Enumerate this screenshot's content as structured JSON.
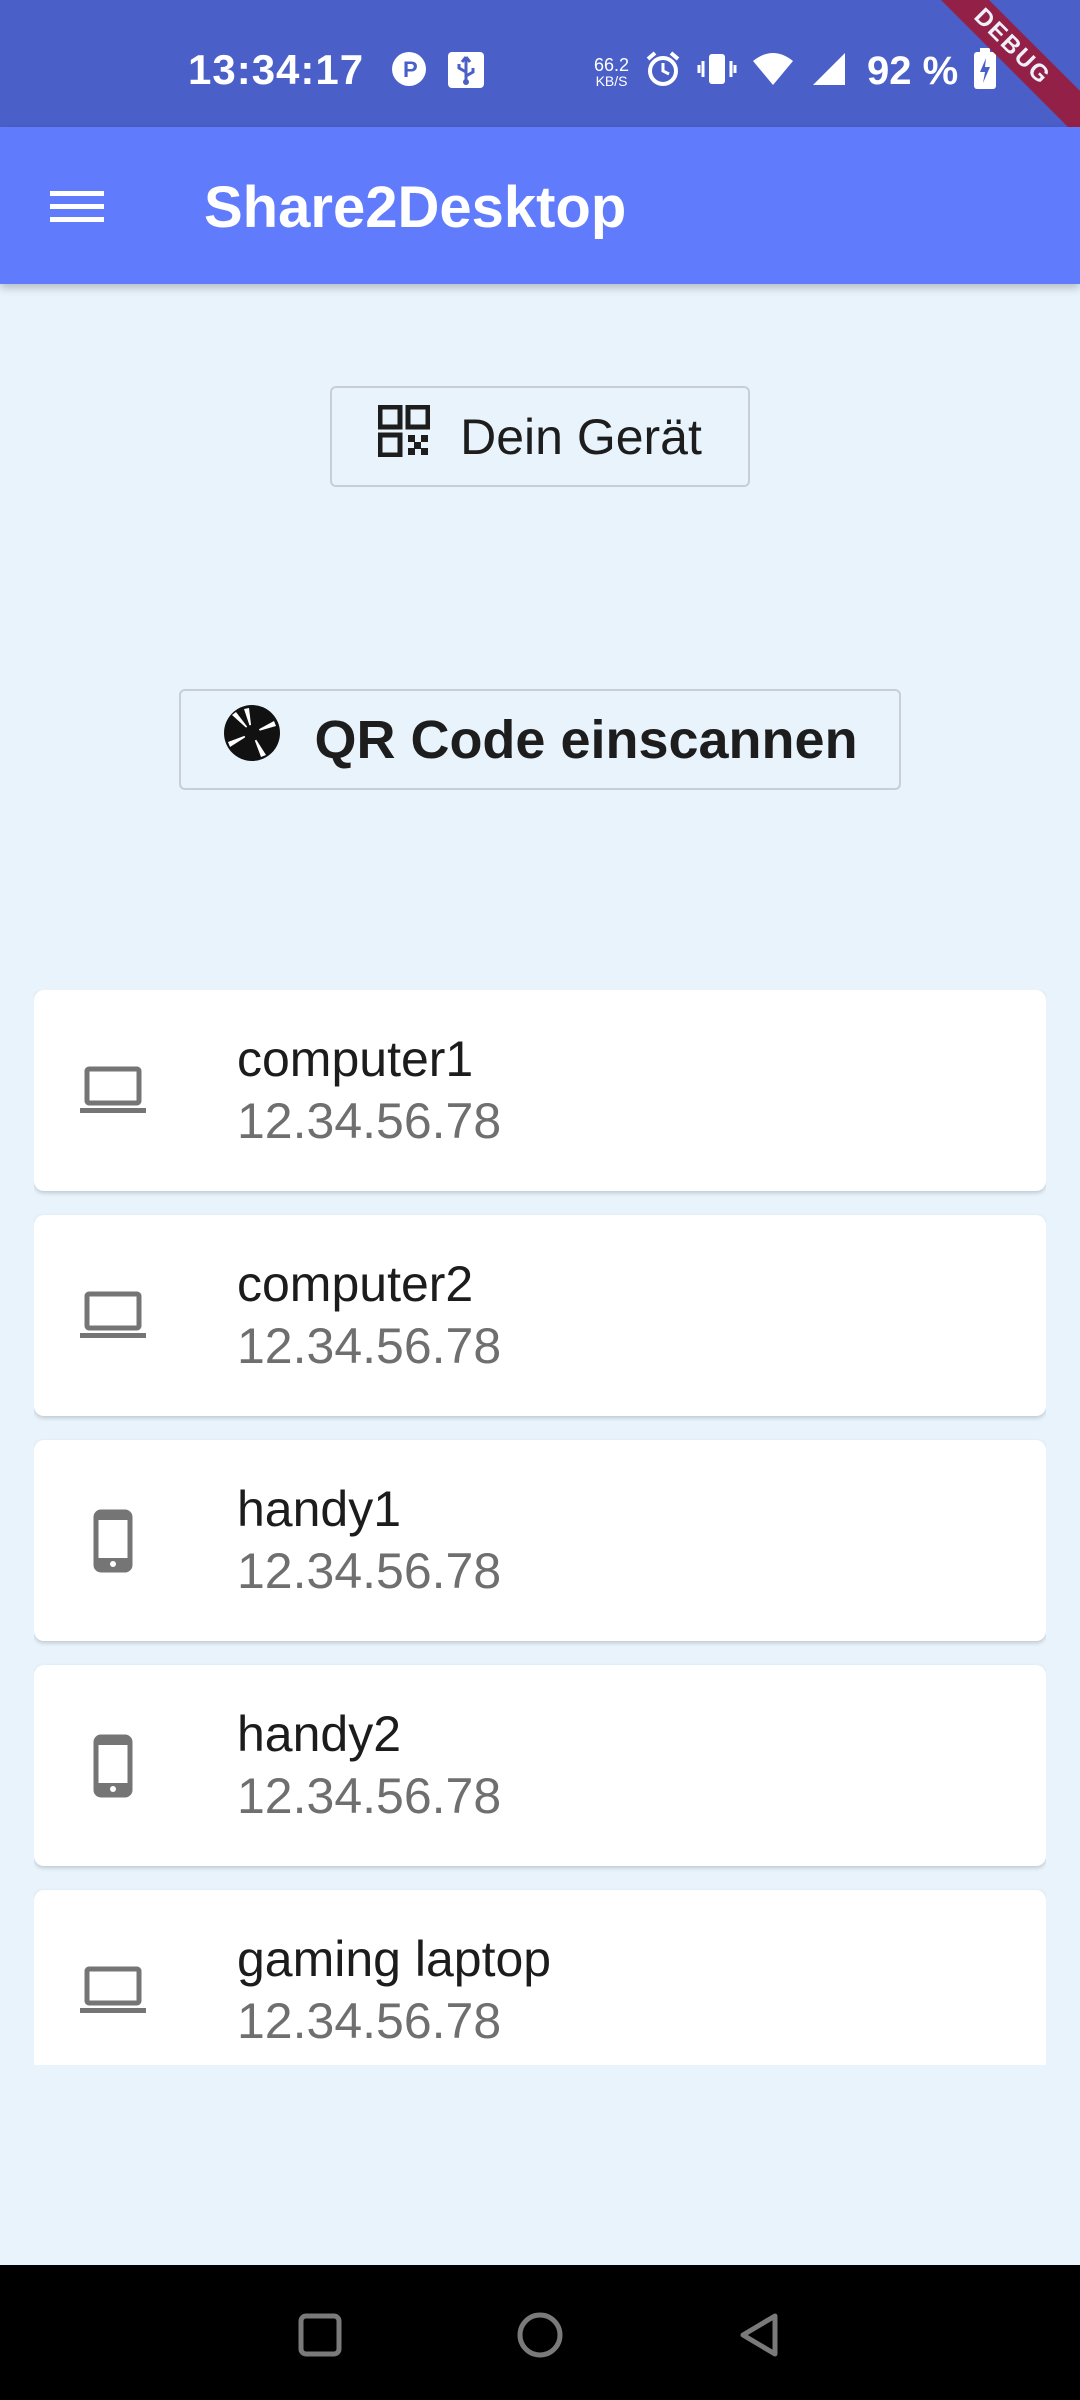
{
  "status_bar": {
    "time": "13:34:17",
    "net_speed_value": "66.2",
    "net_speed_unit": "KB/S",
    "battery": "92 %",
    "debug_label": "DEBUG",
    "left_icons": [
      "p-circle-icon",
      "usb-icon"
    ],
    "right_icons": [
      "alarm-icon",
      "vibrate-icon",
      "wifi-icon",
      "signal-icon",
      "battery-charging-icon"
    ]
  },
  "app_bar": {
    "title": "Share2Desktop",
    "menu_icon": "menu-icon",
    "color": "#607cfd"
  },
  "actions": {
    "your_device_label": "Dein Gerät",
    "your_device_icon": "qr-code-icon",
    "scan_label": "QR Code einscannen",
    "scan_icon": "camera-shutter-icon"
  },
  "devices": [
    {
      "name": "computer1",
      "ip": "12.34.56.78",
      "icon": "laptop-icon"
    },
    {
      "name": "computer2",
      "ip": "12.34.56.78",
      "icon": "laptop-icon"
    },
    {
      "name": "handy1",
      "ip": "12.34.56.78",
      "icon": "smartphone-icon"
    },
    {
      "name": "handy2",
      "ip": "12.34.56.78",
      "icon": "smartphone-icon"
    },
    {
      "name": "gaming laptop",
      "ip": "12.34.56.78",
      "icon": "laptop-icon"
    }
  ],
  "nav_bar": {
    "buttons": [
      "recents-icon",
      "home-icon",
      "back-icon"
    ]
  },
  "colors": {
    "status_bar": "#4a5fc8",
    "background": "#e8f3fc",
    "icon_gray": "#757575"
  }
}
